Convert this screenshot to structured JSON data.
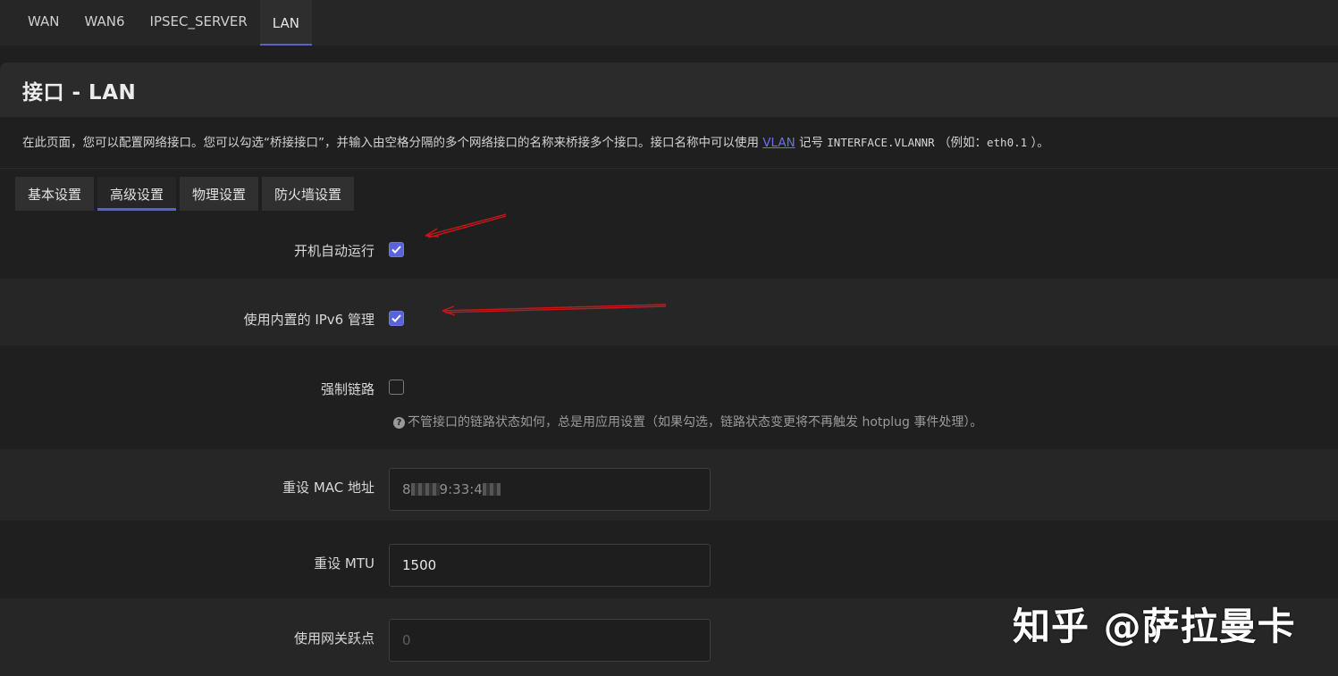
{
  "top_tabs": [
    {
      "label": "WAN",
      "active": false
    },
    {
      "label": "WAN6",
      "active": false
    },
    {
      "label": "IPSEC_SERVER",
      "active": false
    },
    {
      "label": "LAN",
      "active": true
    }
  ],
  "page": {
    "title": "接口 - LAN",
    "desc_prefix": "在此页面，您可以配置网络接口。您可以勾选“桥接接口”，并输入由空格分隔的多个网络接口的名称来桥接多个接口。接口名称中可以使用 ",
    "desc_link": "VLAN",
    "desc_mid": " 记号 ",
    "desc_code1": "INTERFACE.VLANNR",
    "desc_mid2": "（例如：",
    "desc_code2": "eth0.1",
    "desc_suffix": "）。"
  },
  "sub_tabs": [
    {
      "label": "基本设置",
      "active": false
    },
    {
      "label": "高级设置",
      "active": true
    },
    {
      "label": "物理设置",
      "active": false
    },
    {
      "label": "防火墙设置",
      "active": false
    }
  ],
  "fields": {
    "auto_start": {
      "label": "开机自动运行",
      "checked": true
    },
    "ipv6_mgmt": {
      "label": "使用内置的 IPv6 管理",
      "checked": true
    },
    "force_link": {
      "label": "强制链路",
      "checked": false,
      "hint": "不管接口的链路状态如何，总是用应用设置（如果勾选，链路状态变更将不再触发 hotplug 事件处理）。"
    },
    "mac": {
      "label": "重设 MAC 地址",
      "value_start": "8",
      "value_mid": "9:33:4"
    },
    "mtu": {
      "label": "重设 MTU",
      "value": "1500"
    },
    "gateway_metric": {
      "label": "使用网关跃点",
      "placeholder": "0"
    }
  },
  "watermark": "知乎 @萨拉曼卡",
  "colors": {
    "accent": "#5b5fd6",
    "link": "#6a72e6",
    "arrow": "#c8161b"
  }
}
